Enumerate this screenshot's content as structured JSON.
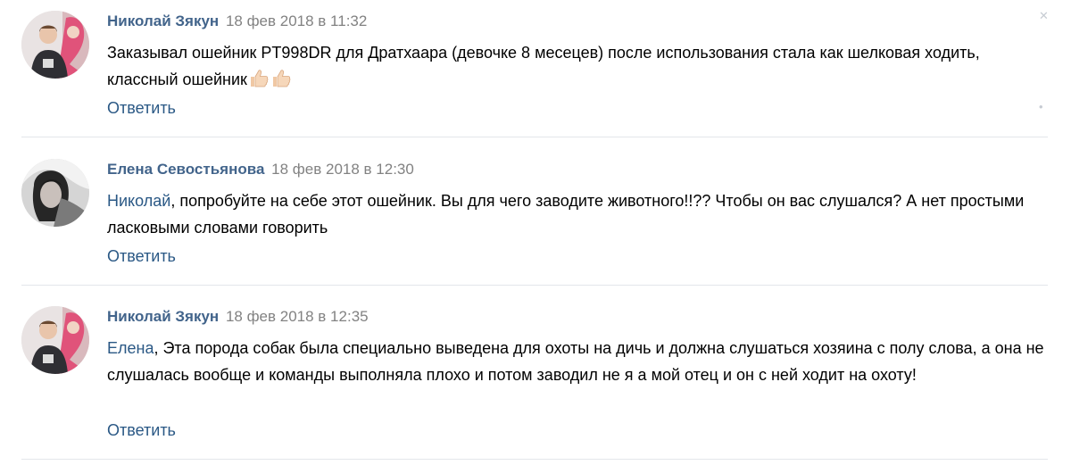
{
  "comments": [
    {
      "author": "Николай Зякун",
      "date": "18 фев 2018 в 11:32",
      "mention": "",
      "text": "Заказывал ошейник PT998DR для Дратхаара (девочке 8 месецев) после использования стала как шелковая ходить, классный ошейник",
      "emoji": [
        "thumbs-up",
        "thumbs-up"
      ],
      "reply_label": "Ответить"
    },
    {
      "author": "Елена Севостьянова",
      "date": "18 фев 2018 в 12:30",
      "mention": "Николай",
      "text": ", попробуйте на себе этот ошейник. Вы для чего заводите животного!!?? Чтобы он вас слушался? А нет простыми ласковыми словами говорить",
      "emoji": [],
      "reply_label": "Ответить"
    },
    {
      "author": "Николай Зякун",
      "date": "18 фев 2018 в 12:35",
      "mention": "Елена",
      "text": ", Эта порода собак была специально выведена для охоты на дичь и должна слушаться хозяина с полу слова, а она не слушалась вообще и команды выполняла плохо и потом заводил не я а мой отец и он с ней ходит на охоту!",
      "emoji": [],
      "reply_label": "Ответить"
    }
  ],
  "colors": {
    "author": "#42648b",
    "link": "#2a5885",
    "date": "#828282",
    "divider": "#e3e6ea"
  }
}
